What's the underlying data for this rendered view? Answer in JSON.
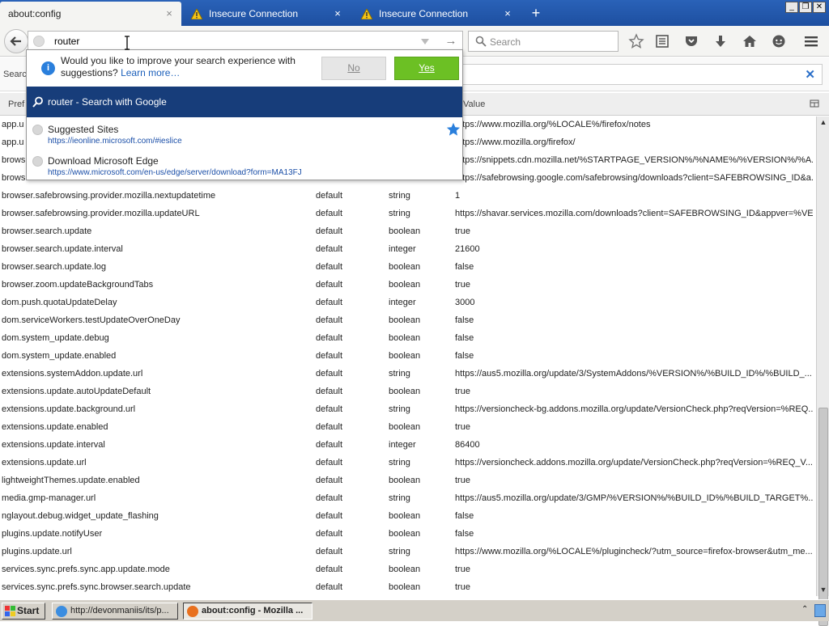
{
  "tabs": [
    {
      "title": "about:config",
      "active": true,
      "warning": false
    },
    {
      "title": "Insecure Connection",
      "active": false,
      "warning": true
    },
    {
      "title": "Insecure Connection",
      "active": false,
      "warning": true
    }
  ],
  "icons": {
    "tab_close": "×",
    "new_tab": "+",
    "go": "→",
    "filter_clear": "✕",
    "window_minimize": "_",
    "window_restore": "❐",
    "window_close": "✕"
  },
  "urlbar": {
    "value": "router"
  },
  "searchbar": {
    "placeholder": "Search"
  },
  "toolbar_icons": [
    "star-icon",
    "reading-list-icon",
    "pocket-icon",
    "download-icon",
    "home-icon",
    "chat-icon",
    "menu-icon"
  ],
  "popup": {
    "notice": {
      "text": "Would you like to improve your search experience with suggestions?",
      "link": "Learn more…",
      "no_label": "No",
      "yes_label": "Yes"
    },
    "search_suggestion": "router - Search with Google",
    "history": [
      {
        "title": "Suggested Sites",
        "url": "https://ieonline.microsoft.com/#ieslice",
        "starred": true
      },
      {
        "title": "Download Microsoft Edge",
        "url": "https://www.microsoft.com/en-us/edge/server/download?form=MA13FJ",
        "starred": false
      }
    ]
  },
  "config": {
    "filter_label": "Searc",
    "columns": {
      "pref": "Pref",
      "value": "Value"
    },
    "partial_rows": [
      {
        "name": "app.u",
        "value": "https://www.mozilla.org/%LOCALE%/firefox/notes"
      },
      {
        "name": "app.u",
        "value": "https://www.mozilla.org/firefox/"
      },
      {
        "name": "brows",
        "value": "https://snippets.cdn.mozilla.net/%STARTPAGE_VERSION%/%NAME%/%VERSION%/%A..."
      },
      {
        "name": "brows",
        "value": "https://safebrowsing.google.com/safebrowsing/downloads?client=SAFEBROWSING_ID&a..."
      }
    ],
    "rows": [
      {
        "name": "browser.safebrowsing.provider.mozilla.nextupdatetime",
        "status": "default",
        "type": "string",
        "value": "1"
      },
      {
        "name": "browser.safebrowsing.provider.mozilla.updateURL",
        "status": "default",
        "type": "string",
        "value": "https://shavar.services.mozilla.com/downloads?client=SAFEBROWSING_ID&appver=%VE..."
      },
      {
        "name": "browser.search.update",
        "status": "default",
        "type": "boolean",
        "value": "true"
      },
      {
        "name": "browser.search.update.interval",
        "status": "default",
        "type": "integer",
        "value": "21600"
      },
      {
        "name": "browser.search.update.log",
        "status": "default",
        "type": "boolean",
        "value": "false"
      },
      {
        "name": "browser.zoom.updateBackgroundTabs",
        "status": "default",
        "type": "boolean",
        "value": "true"
      },
      {
        "name": "dom.push.quotaUpdateDelay",
        "status": "default",
        "type": "integer",
        "value": "3000"
      },
      {
        "name": "dom.serviceWorkers.testUpdateOverOneDay",
        "status": "default",
        "type": "boolean",
        "value": "false"
      },
      {
        "name": "dom.system_update.debug",
        "status": "default",
        "type": "boolean",
        "value": "false"
      },
      {
        "name": "dom.system_update.enabled",
        "status": "default",
        "type": "boolean",
        "value": "false"
      },
      {
        "name": "extensions.systemAddon.update.url",
        "status": "default",
        "type": "string",
        "value": "https://aus5.mozilla.org/update/3/SystemAddons/%VERSION%/%BUILD_ID%/%BUILD_..."
      },
      {
        "name": "extensions.update.autoUpdateDefault",
        "status": "default",
        "type": "boolean",
        "value": "true"
      },
      {
        "name": "extensions.update.background.url",
        "status": "default",
        "type": "string",
        "value": "https://versioncheck-bg.addons.mozilla.org/update/VersionCheck.php?reqVersion=%REQ..."
      },
      {
        "name": "extensions.update.enabled",
        "status": "default",
        "type": "boolean",
        "value": "true"
      },
      {
        "name": "extensions.update.interval",
        "status": "default",
        "type": "integer",
        "value": "86400"
      },
      {
        "name": "extensions.update.url",
        "status": "default",
        "type": "string",
        "value": "https://versioncheck.addons.mozilla.org/update/VersionCheck.php?reqVersion=%REQ_V..."
      },
      {
        "name": "lightweightThemes.update.enabled",
        "status": "default",
        "type": "boolean",
        "value": "true"
      },
      {
        "name": "media.gmp-manager.url",
        "status": "default",
        "type": "string",
        "value": "https://aus5.mozilla.org/update/3/GMP/%VERSION%/%BUILD_ID%/%BUILD_TARGET%..."
      },
      {
        "name": "nglayout.debug.widget_update_flashing",
        "status": "default",
        "type": "boolean",
        "value": "false"
      },
      {
        "name": "plugins.update.notifyUser",
        "status": "default",
        "type": "boolean",
        "value": "false"
      },
      {
        "name": "plugins.update.url",
        "status": "default",
        "type": "string",
        "value": "https://www.mozilla.org/%LOCALE%/plugincheck/?utm_source=firefox-browser&utm_me..."
      },
      {
        "name": "services.sync.prefs.sync.app.update.mode",
        "status": "default",
        "type": "boolean",
        "value": "true"
      },
      {
        "name": "services.sync.prefs.sync.browser.search.update",
        "status": "default",
        "type": "boolean",
        "value": "true"
      }
    ]
  },
  "taskbar": {
    "start_label": "Start",
    "tasks": [
      {
        "label": "http://devonmaniis/its/p...",
        "active": false
      },
      {
        "label": "about:config - Mozilla ...",
        "active": true
      }
    ]
  },
  "colors": {
    "tabstrip": "#1d4fa0",
    "suggestion_bg": "#173d7a",
    "yes_button": "#6cc024",
    "link": "#1b5fba",
    "taskbar": "#d4d0c8"
  }
}
